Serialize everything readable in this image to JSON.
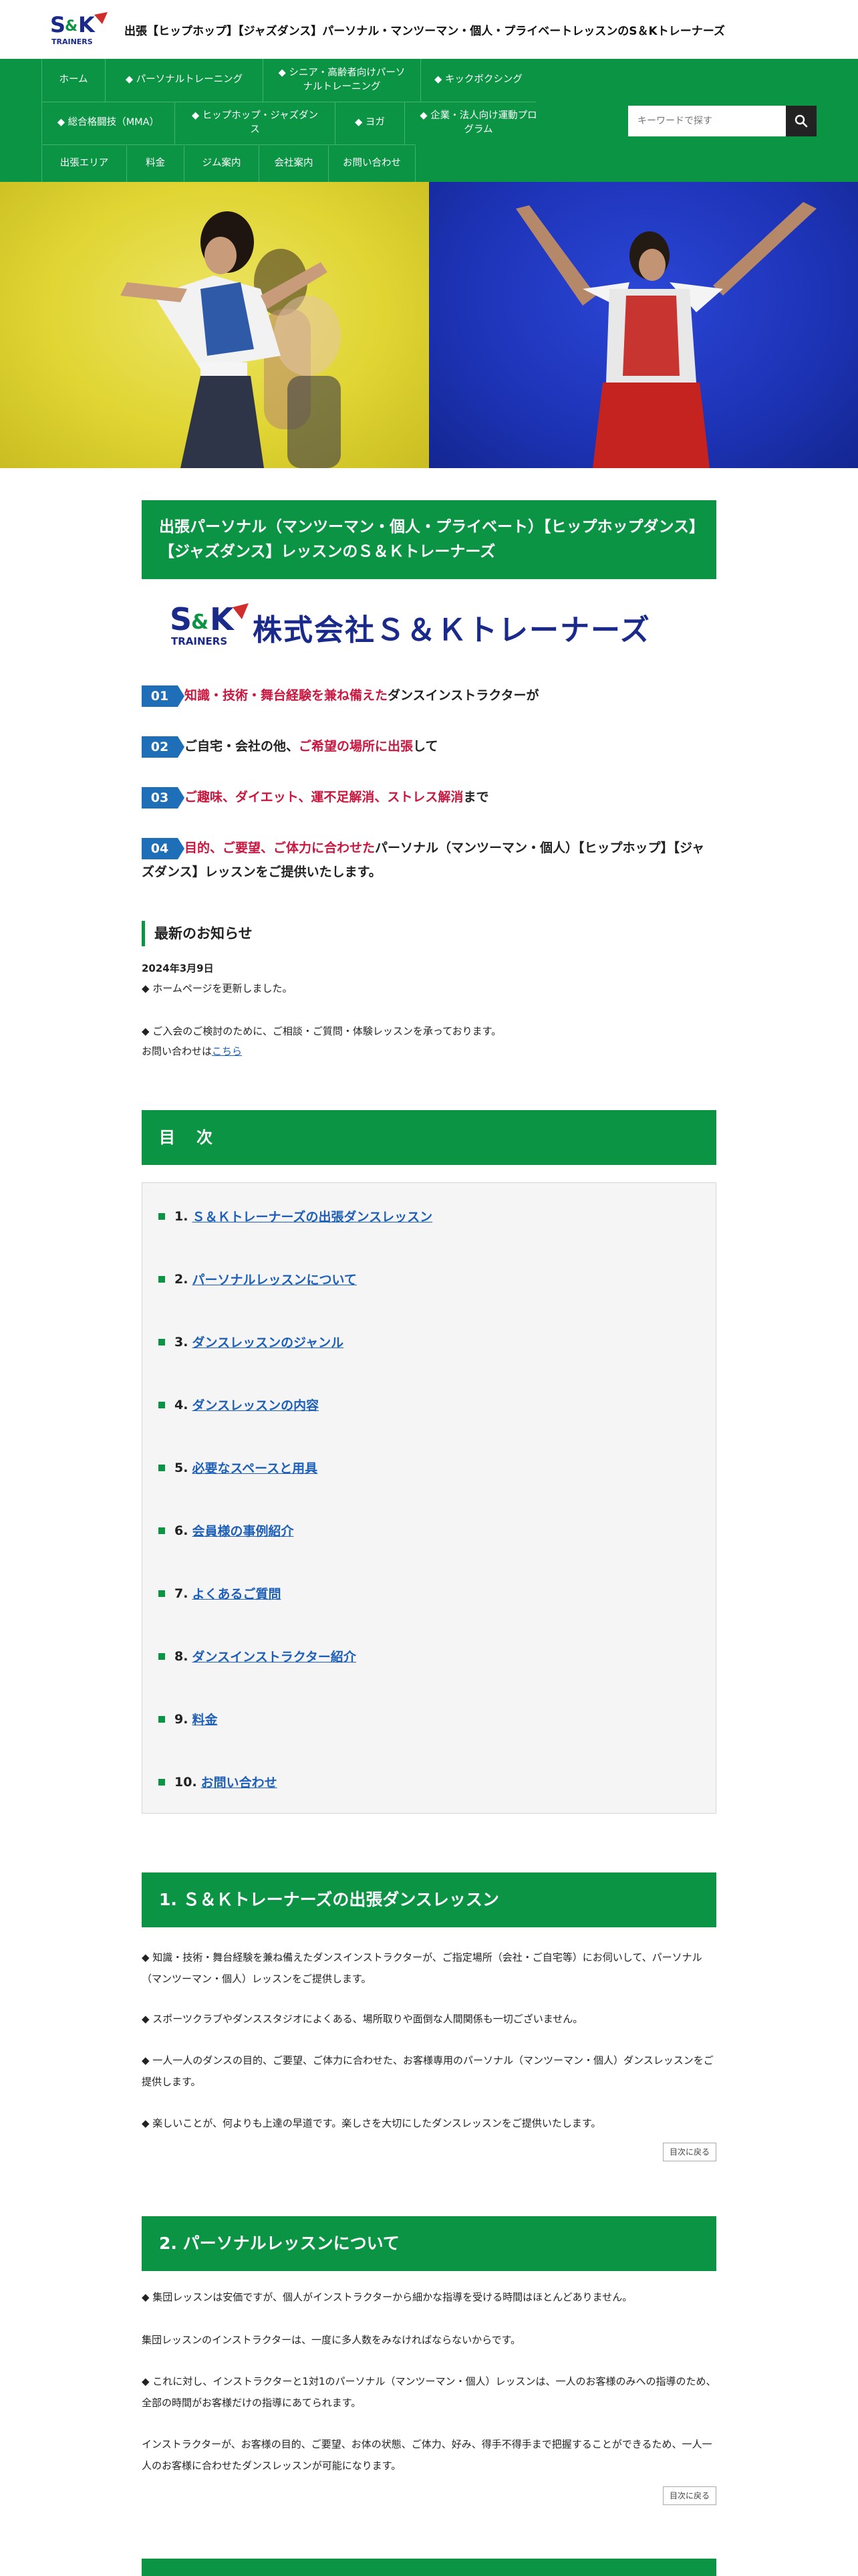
{
  "header": {
    "site_title": "出張【ヒップホップ】【ジャズダンス】パーソナル・マンツーマン・個人・プライベートレッスンのS＆Kトレーナーズ",
    "logo_text": "S&K",
    "logo_sub": "TRAINERS"
  },
  "nav": {
    "items": [
      "ホーム",
      "◆ パーソナルトレーニング",
      "◆ シニア・高齢者向けパーソナルトレーニング",
      "◆ キックボクシング",
      "◆ 総合格闘技（MMA）",
      "◆ ヒップホップ・ジャズダンス",
      "◆ ヨガ",
      "◆ 企業・法人向け運動プログラム",
      "出張エリア",
      "料金",
      "ジム案内",
      "会社案内",
      "お問い合わせ"
    ],
    "search_placeholder": "キーワードで探す"
  },
  "main": {
    "title": "出張パーソナル（マンツーマン・個人・プライベート）【ヒップホップダンス】【ジャズダンス】レッスンのＳ＆Ｋトレーナーズ",
    "company_name": "株式会社Ｓ＆Ｋトレーナーズ",
    "features": [
      {
        "num": "01",
        "red": "知識・技術・舞台経験を兼ね備えた",
        "rest": "ダンスインストラクターが"
      },
      {
        "num": "02",
        "pre": "ご自宅・会社の他、",
        "red": "ご希望の場所に出張",
        "rest": "して"
      },
      {
        "num": "03",
        "red": "ご趣味、ダイエット、運不足解消、ストレス解消",
        "rest": "まで"
      },
      {
        "num": "04",
        "red": "目的、ご要望、ご体力に合わせた",
        "rest": "パーソナル（マンツーマン・個人）【ヒップホップ】【ジャズダンス】レッスンをご提供いたします。"
      }
    ]
  },
  "news": {
    "heading": "最新のお知らせ",
    "date": "2024年3月9日",
    "item1": "◆ ホームページを更新しました。",
    "item2": "◆ ご入会のご検討のために、ご相談・ご質問・体験レッスンを承っております。",
    "contact_prefix": "お問い合わせは",
    "contact_link": "こちら"
  },
  "toc": {
    "title": "目　次",
    "items": [
      {
        "num": "1.",
        "label": "Ｓ＆Ｋトレーナーズの出張ダンスレッスン"
      },
      {
        "num": "2.",
        "label": "パーソナルレッスンについて"
      },
      {
        "num": "3.",
        "label": "ダンスレッスンのジャンル"
      },
      {
        "num": "4.",
        "label": "ダンスレッスンの内容"
      },
      {
        "num": "5.",
        "label": "必要なスペースと用具"
      },
      {
        "num": "6.",
        "label": "会員様の事例紹介"
      },
      {
        "num": "7.",
        "label": "よくあるご質問"
      },
      {
        "num": "8.",
        "label": "ダンスインストラクター紹介"
      },
      {
        "num": "9.",
        "label": "料金"
      },
      {
        "num": "10.",
        "label": "お問い合わせ"
      }
    ]
  },
  "section1": {
    "title": "1. Ｓ＆Ｋトレーナーズの出張ダンスレッスン",
    "p1": "◆ 知識・技術・舞台経験を兼ね備えたダンスインストラクターが、ご指定場所（会社・ご自宅等）にお伺いして、パーソナル（マンツーマン・個人）レッスンをご提供します。",
    "p2": "◆ スポーツクラブやダンススタジオによくある、場所取りや面倒な人間関係も一切ございません。",
    "p3": "◆ 一人一人のダンスの目的、ご要望、ご体力に合わせた、お客様専用のパーソナル（マンツーマン・個人）ダンスレッスンをご提供します。",
    "p4": "◆ 楽しいことが、何よりも上達の早道です。楽しさを大切にしたダンスレッスンをご提供いたします。",
    "back": "目次に戻る"
  },
  "section2": {
    "title": "2. パーソナルレッスンについて",
    "p1": "◆ 集団レッスンは安価ですが、個人がインストラクターから細かな指導を受ける時間はほとんどありません。",
    "p2": "集団レッスンのインストラクターは、一度に多人数をみなければならないからです。",
    "p3": "◆ これに対し、インストラクターと1対1のパーソナル（マンツーマン・個人）レッスンは、一人のお客様のみへの指導のため、全部の時間がお客様だけの指導にあてられます。",
    "p4": "インストラクターが、お客様の目的、ご要望、お体の状態、ご体力、好み、得手不得手まで把握することができるため、一人一人のお客様に合わせたダンスレッスンが可能になります。",
    "back": "目次に戻る"
  },
  "colors": {
    "brand_green": "#0b9444",
    "badge_blue": "#1e6fb8",
    "accent_red": "#c9173f",
    "link_blue": "#1e5fb8"
  }
}
